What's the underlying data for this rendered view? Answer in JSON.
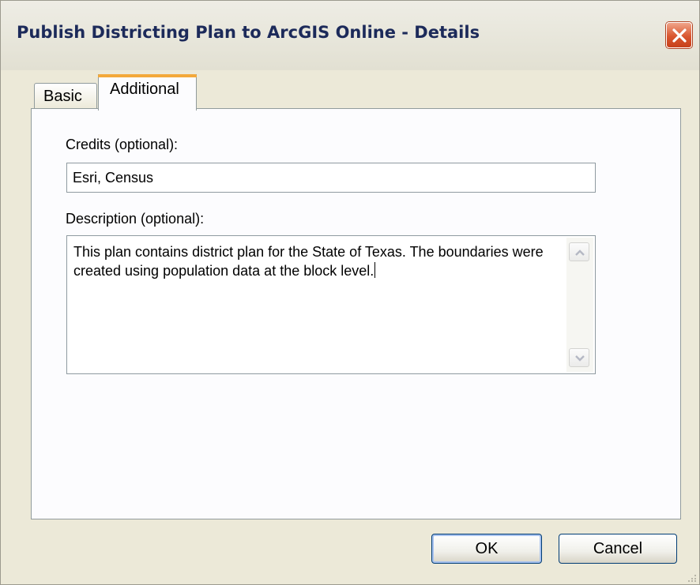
{
  "window": {
    "title": "Publish Districting Plan to ArcGIS Online - Details"
  },
  "tabs": [
    {
      "label": "Basic",
      "selected": false
    },
    {
      "label": "Additional",
      "selected": true
    }
  ],
  "form": {
    "credits_label": "Credits (optional):",
    "credits_value": "Esri, Census",
    "description_label": "Description (optional):",
    "description_value": "This plan contains district plan for the State of Texas. The boundaries were created using population data at the block level."
  },
  "buttons": {
    "ok": "OK",
    "cancel": "Cancel"
  },
  "colors": {
    "dialog_bg": "#ece9d8",
    "close_button": "#d9562f",
    "selected_tab_highlight": "#f3a93a",
    "title_text": "#1c2a5a"
  }
}
